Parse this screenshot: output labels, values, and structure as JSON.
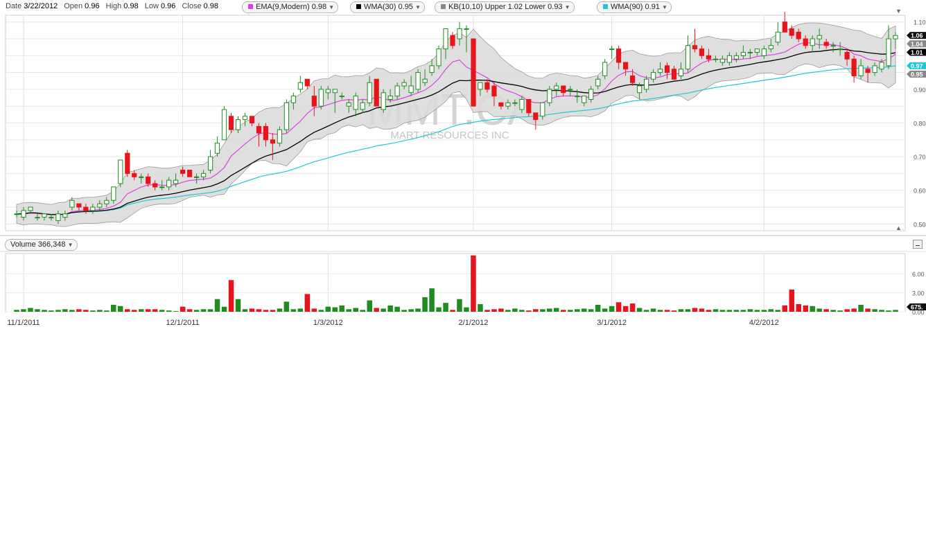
{
  "header": {
    "date_label": "Date",
    "date_value": "3/22/2012",
    "open_label": "Open",
    "open_value": "0.96",
    "high_label": "High",
    "high_value": "0.98",
    "low_label": "Low",
    "low_value": "0.96",
    "close_label": "Close",
    "close_value": "0.98",
    "indicators": [
      {
        "text": "EMA(9,Modern)",
        "value": "0.98",
        "color": "#e040e0"
      },
      {
        "text": "WMA(30)",
        "value": "0.95",
        "color": "#000000"
      },
      {
        "text": "KB(10,10)",
        "upper_label": "Upper",
        "upper": "1.02",
        "lower_label": "Lower",
        "lower": "0.93",
        "color": "#888888"
      },
      {
        "text": "WMA(90)",
        "value": "0.91",
        "color": "#1fc8d6"
      }
    ]
  },
  "watermark": {
    "symbol": "MMT.CA",
    "name": "MART RESOURCES INC"
  },
  "volume_panel": {
    "label": "Volume",
    "value": "366,348",
    "last_tag": "675."
  },
  "colors": {
    "up": "#1e8c1e",
    "down": "#e8141b",
    "ema": "#e040e0",
    "wma30": "#000000",
    "wma90": "#1fc8d6",
    "band": "#d9d9d9"
  },
  "chart_data": {
    "type": "candlestick",
    "y_range": [
      0.48,
      1.12
    ],
    "y_ticks": [
      "1.10",
      "0.90",
      "0.80",
      "0.70",
      "0.60",
      "0.50"
    ],
    "y_tags": [
      {
        "label": "1.06",
        "value": 1.06,
        "color": "#111111"
      },
      {
        "label": "1.04",
        "value": 1.035,
        "color": "#888888"
      },
      {
        "label": "1.01",
        "value": 1.01,
        "color": "#000000"
      },
      {
        "label": "0.97",
        "value": 0.97,
        "color": "#1fc8d6"
      },
      {
        "label": "0.95",
        "value": 0.945,
        "color": "#888888"
      }
    ],
    "x_ticks": [
      "11/1/2011",
      "12/1/2011",
      "1/3/2012",
      "2/1/2012",
      "3/1/2012",
      "4/2/2012"
    ],
    "x_tick_index": [
      1,
      24,
      45,
      66,
      86,
      108
    ],
    "volume_ticks": [
      "6.00",
      "3.00",
      "0.00"
    ],
    "volume_range": [
      0,
      9.2
    ],
    "close": [
      0.53,
      0.53,
      0.54,
      0.53,
      0.52,
      0.52,
      0.53,
      0.53,
      0.57,
      0.55,
      0.55,
      0.54,
      0.55,
      0.56,
      0.58,
      0.61,
      0.69,
      0.64,
      0.65,
      0.64,
      0.62,
      0.61,
      0.61,
      0.63,
      0.65,
      0.65,
      0.64,
      0.64,
      0.65,
      0.7,
      0.74,
      0.84,
      0.79,
      0.81,
      0.82,
      0.82,
      0.79,
      0.75,
      0.76,
      0.78,
      0.86,
      0.88,
      0.92,
      0.91,
      0.86,
      0.88,
      0.89,
      0.89,
      0.88,
      0.86,
      0.88,
      0.86,
      0.92,
      0.85,
      0.84,
      0.88,
      0.9,
      0.91,
      0.92,
      0.93,
      0.97,
      1.01,
      1.07,
      1.07,
      1.01,
      0.88,
      0.92,
      0.9,
      0.89,
      0.85,
      0.85,
      0.86,
      0.86,
      0.84,
      0.81,
      0.84,
      0.86,
      0.91,
      0.91,
      0.89,
      0.88,
      0.88,
      0.86,
      0.88,
      0.91,
      0.97,
      1.02,
      1.01,
      0.99,
      0.96,
      0.89,
      0.91,
      0.93,
      0.95,
      0.97,
      0.96,
      0.94,
      0.96,
      1.03,
      1.03,
      1.02,
      1.0,
      0.99,
      0.99,
      0.98,
      1.0,
      1.0,
      1.02,
      1.01,
      1.01,
      1.02,
      1.03,
      1.07,
      1.08,
      1.06,
      1.03,
      1.01,
      1.04,
      1.03,
      1.01,
      0.99,
      0.94,
      0.98,
      0.95,
      0.97,
      0.97,
      1.02,
      1.06
    ],
    "candles": [
      [
        0.53,
        0.54,
        0.52,
        0.53
      ],
      [
        0.52,
        0.55,
        0.51,
        0.54
      ],
      [
        0.54,
        0.55,
        0.53,
        0.55
      ],
      [
        0.52,
        0.53,
        0.51,
        0.52
      ],
      [
        0.52,
        0.53,
        0.51,
        0.53
      ],
      [
        0.52,
        0.53,
        0.51,
        0.52
      ],
      [
        0.51,
        0.54,
        0.5,
        0.53
      ],
      [
        0.52,
        0.54,
        0.51,
        0.53
      ],
      [
        0.55,
        0.58,
        0.54,
        0.57
      ],
      [
        0.56,
        0.56,
        0.54,
        0.55
      ],
      [
        0.55,
        0.56,
        0.53,
        0.54
      ],
      [
        0.54,
        0.56,
        0.53,
        0.55
      ],
      [
        0.55,
        0.57,
        0.54,
        0.56
      ],
      [
        0.56,
        0.58,
        0.55,
        0.57
      ],
      [
        0.57,
        0.61,
        0.56,
        0.61
      ],
      [
        0.62,
        0.69,
        0.61,
        0.69
      ],
      [
        0.71,
        0.72,
        0.64,
        0.65
      ],
      [
        0.65,
        0.66,
        0.63,
        0.64
      ],
      [
        0.64,
        0.65,
        0.62,
        0.64
      ],
      [
        0.64,
        0.65,
        0.61,
        0.62
      ],
      [
        0.62,
        0.63,
        0.6,
        0.61
      ],
      [
        0.61,
        0.63,
        0.6,
        0.61
      ],
      [
        0.61,
        0.64,
        0.6,
        0.63
      ],
      [
        0.62,
        0.65,
        0.61,
        0.63
      ],
      [
        0.66,
        0.67,
        0.64,
        0.65
      ],
      [
        0.66,
        0.66,
        0.64,
        0.64
      ],
      [
        0.64,
        0.65,
        0.62,
        0.64
      ],
      [
        0.64,
        0.66,
        0.63,
        0.65
      ],
      [
        0.66,
        0.72,
        0.65,
        0.7
      ],
      [
        0.71,
        0.76,
        0.7,
        0.74
      ],
      [
        0.75,
        0.85,
        0.75,
        0.84
      ],
      [
        0.82,
        0.83,
        0.77,
        0.78
      ],
      [
        0.78,
        0.82,
        0.77,
        0.81
      ],
      [
        0.81,
        0.83,
        0.79,
        0.82
      ],
      [
        0.82,
        0.82,
        0.79,
        0.8
      ],
      [
        0.79,
        0.8,
        0.73,
        0.77
      ],
      [
        0.79,
        0.8,
        0.73,
        0.75
      ],
      [
        0.75,
        0.77,
        0.69,
        0.74
      ],
      [
        0.74,
        0.79,
        0.73,
        0.78
      ],
      [
        0.78,
        0.87,
        0.77,
        0.86
      ],
      [
        0.86,
        0.89,
        0.84,
        0.88
      ],
      [
        0.9,
        0.94,
        0.89,
        0.92
      ],
      [
        0.93,
        0.93,
        0.9,
        0.91
      ],
      [
        0.88,
        0.91,
        0.82,
        0.85
      ],
      [
        0.85,
        0.91,
        0.84,
        0.9
      ],
      [
        0.89,
        0.91,
        0.87,
        0.9
      ],
      [
        0.89,
        0.9,
        0.83,
        0.9
      ],
      [
        0.88,
        0.89,
        0.87,
        0.88
      ],
      [
        0.85,
        0.87,
        0.83,
        0.86
      ],
      [
        0.84,
        0.89,
        0.82,
        0.88
      ],
      [
        0.84,
        0.87,
        0.83,
        0.86
      ],
      [
        0.86,
        0.94,
        0.85,
        0.92
      ],
      [
        0.93,
        0.93,
        0.85,
        0.85
      ],
      [
        0.84,
        0.9,
        0.83,
        0.89
      ],
      [
        0.87,
        0.9,
        0.86,
        0.88
      ],
      [
        0.88,
        0.92,
        0.87,
        0.91
      ],
      [
        0.91,
        0.93,
        0.9,
        0.92
      ],
      [
        0.89,
        0.94,
        0.88,
        0.91
      ],
      [
        0.9,
        0.96,
        0.89,
        0.95
      ],
      [
        0.92,
        0.96,
        0.91,
        0.93
      ],
      [
        0.95,
        0.99,
        0.94,
        0.97
      ],
      [
        0.97,
        1.03,
        0.96,
        1.02
      ],
      [
        1.02,
        1.08,
        0.99,
        1.08
      ],
      [
        1.06,
        1.07,
        1.02,
        1.03
      ],
      [
        1.05,
        1.1,
        1.03,
        1.08
      ],
      [
        1.08,
        1.09,
        1.01,
        1.08
      ],
      [
        1.05,
        1.05,
        0.86,
        0.85
      ],
      [
        0.9,
        0.92,
        0.88,
        0.92
      ],
      [
        0.92,
        0.93,
        0.89,
        0.9
      ],
      [
        0.91,
        0.92,
        0.85,
        0.88
      ],
      [
        0.86,
        0.86,
        0.84,
        0.85
      ],
      [
        0.85,
        0.87,
        0.84,
        0.86
      ],
      [
        0.86,
        0.87,
        0.85,
        0.86
      ],
      [
        0.84,
        0.88,
        0.83,
        0.87
      ],
      [
        0.87,
        0.87,
        0.82,
        0.83
      ],
      [
        0.83,
        0.83,
        0.78,
        0.81
      ],
      [
        0.82,
        0.86,
        0.81,
        0.86
      ],
      [
        0.86,
        0.91,
        0.85,
        0.9
      ],
      [
        0.9,
        0.92,
        0.88,
        0.91
      ],
      [
        0.91,
        0.91,
        0.88,
        0.89
      ],
      [
        0.9,
        0.91,
        0.88,
        0.9
      ],
      [
        0.88,
        0.9,
        0.86,
        0.88
      ],
      [
        0.86,
        0.88,
        0.85,
        0.88
      ],
      [
        0.87,
        0.91,
        0.86,
        0.9
      ],
      [
        0.91,
        0.94,
        0.9,
        0.93
      ],
      [
        0.94,
        0.99,
        0.93,
        0.98
      ],
      [
        1.02,
        1.03,
        0.99,
        1.02
      ],
      [
        1.02,
        1.03,
        0.96,
        0.98
      ],
      [
        0.98,
        0.98,
        0.94,
        0.96
      ],
      [
        0.94,
        0.96,
        0.91,
        0.92
      ],
      [
        0.89,
        0.92,
        0.87,
        0.91
      ],
      [
        0.9,
        0.94,
        0.89,
        0.93
      ],
      [
        0.93,
        0.96,
        0.92,
        0.95
      ],
      [
        0.95,
        0.98,
        0.94,
        0.96
      ],
      [
        0.97,
        0.98,
        0.93,
        0.95
      ],
      [
        0.96,
        0.97,
        0.93,
        0.93
      ],
      [
        0.94,
        0.98,
        0.93,
        0.96
      ],
      [
        0.96,
        1.06,
        0.95,
        1.03
      ],
      [
        1.03,
        1.08,
        1.01,
        1.02
      ],
      [
        1.02,
        1.03,
        0.99,
        1.0
      ],
      [
        1.0,
        1.02,
        0.98,
        0.99
      ],
      [
        0.99,
        1.0,
        0.98,
        0.99
      ],
      [
        0.98,
        1.0,
        0.97,
        0.99
      ],
      [
        0.98,
        1.01,
        0.97,
        1.0
      ],
      [
        0.99,
        1.01,
        0.98,
        1.0
      ],
      [
        1.0,
        1.03,
        0.99,
        1.01
      ],
      [
        1.01,
        1.02,
        0.99,
        1.01
      ],
      [
        1.01,
        1.02,
        1.0,
        1.02
      ],
      [
        1.0,
        1.03,
        0.99,
        1.02
      ],
      [
        1.02,
        1.05,
        1.01,
        1.03
      ],
      [
        1.04,
        1.1,
        1.03,
        1.07
      ],
      [
        1.1,
        1.13,
        1.07,
        1.07
      ],
      [
        1.08,
        1.09,
        1.05,
        1.06
      ],
      [
        1.07,
        1.08,
        1.04,
        1.05
      ],
      [
        1.05,
        1.06,
        1.02,
        1.03
      ],
      [
        1.03,
        1.06,
        1.01,
        1.05
      ],
      [
        1.05,
        1.08,
        1.02,
        1.06
      ],
      [
        1.04,
        1.05,
        1.02,
        1.03
      ],
      [
        1.03,
        1.04,
        1.01,
        1.03
      ],
      [
        1.02,
        1.04,
        1.0,
        1.02
      ],
      [
        1.01,
        1.02,
        0.97,
        0.99
      ],
      [
        0.99,
        1.0,
        0.92,
        0.94
      ],
      [
        0.94,
        0.99,
        0.93,
        0.97
      ],
      [
        0.96,
        0.97,
        0.92,
        0.95
      ],
      [
        0.95,
        0.98,
        0.94,
        0.97
      ],
      [
        0.96,
        0.99,
        0.95,
        0.98
      ],
      [
        0.97,
        1.09,
        0.96,
        1.05
      ],
      [
        1.05,
        1.07,
        1.02,
        1.06
      ]
    ],
    "volume": [
      0.3,
      0.4,
      0.6,
      0.4,
      0.3,
      0.2,
      0.3,
      0.4,
      0.3,
      0.4,
      0.3,
      0.2,
      0.3,
      0.2,
      1.1,
      0.9,
      0.4,
      0.3,
      0.4,
      0.4,
      0.4,
      0.3,
      0.2,
      0.1,
      0.8,
      0.4,
      0.3,
      0.4,
      0.4,
      2.0,
      0.8,
      5.0,
      2.0,
      0.4,
      0.5,
      0.4,
      0.3,
      0.3,
      0.5,
      1.6,
      0.4,
      0.5,
      2.8,
      0.5,
      0.3,
      0.8,
      0.7,
      1.0,
      0.4,
      0.6,
      0.3,
      1.8,
      0.6,
      0.5,
      1.0,
      0.8,
      0.3,
      0.4,
      0.5,
      2.3,
      3.7,
      0.7,
      1.4,
      0.3,
      2.0,
      0.7,
      8.9,
      1.2,
      0.3,
      0.4,
      0.5,
      0.3,
      0.5,
      0.3,
      0.2,
      0.4,
      0.4,
      0.5,
      0.6,
      0.3,
      0.3,
      0.4,
      0.5,
      0.4,
      1.1,
      0.5,
      0.9,
      1.5,
      0.9,
      1.3,
      0.6,
      0.3,
      0.5,
      0.3,
      0.3,
      0.2,
      0.4,
      0.4,
      0.6,
      0.5,
      0.3,
      0.4,
      0.3,
      0.3,
      0.3,
      0.3,
      0.4,
      0.3,
      0.3,
      0.4,
      0.3,
      1.0,
      3.5,
      1.2,
      1.0,
      0.9,
      0.5,
      0.4,
      0.3,
      0.2,
      0.4,
      0.5,
      1.1,
      0.5,
      0.4,
      0.3,
      0.2,
      0.3,
      0.3,
      0.4,
      0.3,
      0.6,
      0.4,
      0.3,
      0.5,
      0.4,
      0.3,
      0.5,
      0.3,
      0.5,
      0.4,
      0.7,
      0.3,
      0.4,
      0.3,
      0.4,
      1.2,
      0.6
    ]
  }
}
